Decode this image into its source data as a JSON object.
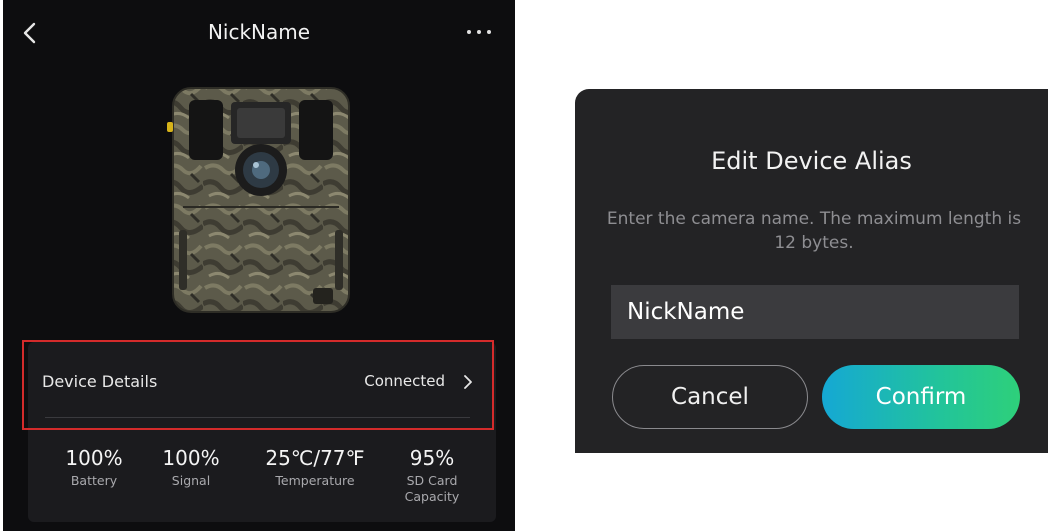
{
  "phone": {
    "title": "NickName",
    "device_details": {
      "label": "Device Details",
      "status": "Connected",
      "highlight_color": "#d42b2b"
    },
    "stats": [
      {
        "value": "100%",
        "label": "Battery"
      },
      {
        "value": "100%",
        "label": "Signal"
      },
      {
        "value": "25℃/77℉",
        "label": "Temperature"
      },
      {
        "value": "95%",
        "label": "SD Card Capacity"
      }
    ]
  },
  "dialog": {
    "title": "Edit Device Alias",
    "description": "Enter the camera name. The maximum length is 12 bytes.",
    "input_value": "NickName",
    "cancel_label": "Cancel",
    "confirm_label": "Confirm",
    "confirm_gradient": [
      "#15a8d4",
      "#2ed07a"
    ]
  },
  "icons": [
    "back-arrow-icon",
    "more-dots-icon",
    "chevron-right-icon",
    "trail-camera-image"
  ]
}
